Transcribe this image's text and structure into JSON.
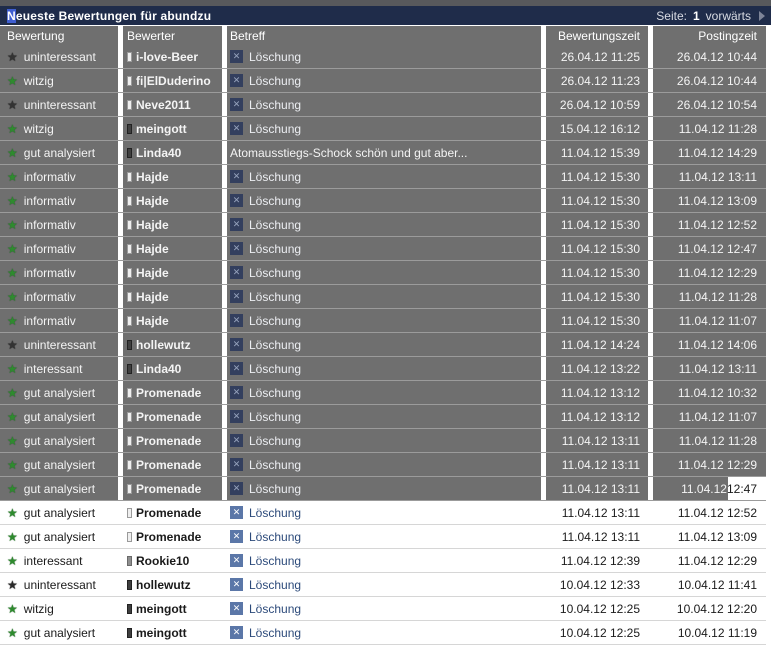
{
  "titlebar": {
    "title_anchor_char": "N",
    "title_rest": "euste",
    "title_full": "Neueste Bewertungen für abundzu",
    "title_selected_first": "N",
    "title_remainder": "eueste Bewertungen für abundzu",
    "page_label": "Seite:",
    "page_number": "1",
    "forward_label": "vorwärts"
  },
  "colors": {
    "titlebar_bg": "#1f2c4a",
    "top_strip": "#58595c",
    "header_bg": "#6f6f6f",
    "selection_bg": "#6f6f6f",
    "selection_anchor": "#3f5ed0",
    "link_blue": "#2c4a7a",
    "x_icon_bg": "#5b77a8",
    "x_icon_selected_bg": "#333f5e",
    "star_positive": "#2e8b2e",
    "star_negative": "#2b2b2b"
  },
  "columns": [
    {
      "label": "Bewertung",
      "align": "left"
    },
    {
      "label": "Bewerter",
      "align": "left"
    },
    {
      "label": "Betreff",
      "align": "left"
    },
    {
      "label": "Bewertungszeit",
      "align": "right"
    },
    {
      "label": "Postingzeit",
      "align": "right"
    }
  ],
  "subject_delete_label": "Löschung",
  "rows": [
    {
      "rating": "uninteressant",
      "rating_type": "neg",
      "user": "i-love-Beer",
      "user_icon": "light",
      "subject_kind": "delete_link",
      "subject": "Löschung",
      "btime": "26.04.12 11:25",
      "ptime": "26.04.12 10:44",
      "selected": true
    },
    {
      "rating": "witzig",
      "rating_type": "pos",
      "user": "fi|ElDuderino",
      "user_icon": "light",
      "subject_kind": "delete_link",
      "subject": "Löschung",
      "btime": "26.04.12 11:23",
      "ptime": "26.04.12 10:44",
      "selected": true
    },
    {
      "rating": "uninteressant",
      "rating_type": "neg",
      "user": "Neve2011",
      "user_icon": "light",
      "subject_kind": "delete_link",
      "subject": "Löschung",
      "btime": "26.04.12 10:59",
      "ptime": "26.04.12 10:54",
      "selected": true
    },
    {
      "rating": "witzig",
      "rating_type": "pos",
      "user": "meingott",
      "user_icon": "dark",
      "subject_kind": "delete_link",
      "subject": "Löschung",
      "btime": "15.04.12 16:12",
      "ptime": "11.04.12 11:28",
      "selected": true
    },
    {
      "rating": "gut analysiert",
      "rating_type": "pos",
      "user": "Linda40",
      "user_icon": "dark",
      "subject_kind": "text",
      "subject": "Atomausstiegs-Schock schön und gut aber...",
      "btime": "11.04.12 15:39",
      "ptime": "11.04.12 14:29",
      "selected": true
    },
    {
      "rating": "informativ",
      "rating_type": "pos",
      "user": "Hajde",
      "user_icon": "light",
      "subject_kind": "delete_link",
      "subject": "Löschung",
      "btime": "11.04.12 15:30",
      "ptime": "11.04.12 13:11",
      "selected": true
    },
    {
      "rating": "informativ",
      "rating_type": "pos",
      "user": "Hajde",
      "user_icon": "light",
      "subject_kind": "delete_link",
      "subject": "Löschung",
      "btime": "11.04.12 15:30",
      "ptime": "11.04.12 13:09",
      "selected": true
    },
    {
      "rating": "informativ",
      "rating_type": "pos",
      "user": "Hajde",
      "user_icon": "light",
      "subject_kind": "delete_link",
      "subject": "Löschung",
      "btime": "11.04.12 15:30",
      "ptime": "11.04.12 12:52",
      "selected": true
    },
    {
      "rating": "informativ",
      "rating_type": "pos",
      "user": "Hajde",
      "user_icon": "light",
      "subject_kind": "delete_link",
      "subject": "Löschung",
      "btime": "11.04.12 15:30",
      "ptime": "11.04.12 12:47",
      "selected": true
    },
    {
      "rating": "informativ",
      "rating_type": "pos",
      "user": "Hajde",
      "user_icon": "light",
      "subject_kind": "delete_link",
      "subject": "Löschung",
      "btime": "11.04.12 15:30",
      "ptime": "11.04.12 12:29",
      "selected": true
    },
    {
      "rating": "informativ",
      "rating_type": "pos",
      "user": "Hajde",
      "user_icon": "light",
      "subject_kind": "delete_link",
      "subject": "Löschung",
      "btime": "11.04.12 15:30",
      "ptime": "11.04.12 11:28",
      "selected": true
    },
    {
      "rating": "informativ",
      "rating_type": "pos",
      "user": "Hajde",
      "user_icon": "light",
      "subject_kind": "delete_link",
      "subject": "Löschung",
      "btime": "11.04.12 15:30",
      "ptime": "11.04.12 11:07",
      "selected": true
    },
    {
      "rating": "uninteressant",
      "rating_type": "neg",
      "user": "hollewutz",
      "user_icon": "dark",
      "subject_kind": "delete_link",
      "subject": "Löschung",
      "btime": "11.04.12 14:24",
      "ptime": "11.04.12 14:06",
      "selected": true
    },
    {
      "rating": "interessant",
      "rating_type": "pos",
      "user": "Linda40",
      "user_icon": "dark",
      "subject_kind": "delete_link",
      "subject": "Löschung",
      "btime": "11.04.12 13:22",
      "ptime": "11.04.12 13:11",
      "selected": true
    },
    {
      "rating": "gut analysiert",
      "rating_type": "pos",
      "user": "Promenade",
      "user_icon": "light",
      "subject_kind": "delete_link",
      "subject": "Löschung",
      "btime": "11.04.12 13:12",
      "ptime": "11.04.12 10:32",
      "selected": true
    },
    {
      "rating": "gut analysiert",
      "rating_type": "pos",
      "user": "Promenade",
      "user_icon": "light",
      "subject_kind": "delete_link",
      "subject": "Löschung",
      "btime": "11.04.12 13:12",
      "ptime": "11.04.12 11:07",
      "selected": true
    },
    {
      "rating": "gut analysiert",
      "rating_type": "pos",
      "user": "Promenade",
      "user_icon": "light",
      "subject_kind": "delete_link",
      "subject": "Löschung",
      "btime": "11.04.12 13:11",
      "ptime": "11.04.12 11:28",
      "selected": true
    },
    {
      "rating": "gut analysiert",
      "rating_type": "pos",
      "user": "Promenade",
      "user_icon": "light",
      "subject_kind": "delete_link",
      "subject": "Löschung",
      "btime": "11.04.12 13:11",
      "ptime": "11.04.12 12:29",
      "selected": true
    },
    {
      "rating": "gut analysiert",
      "rating_type": "pos",
      "user": "Promenade",
      "user_icon": "light",
      "subject_kind": "delete_link",
      "subject": "Löschung",
      "btime": "11.04.12 13:11",
      "ptime_selected_part": "11.04.12 ",
      "ptime_unselected_part": "12:47",
      "ptime": "11.04.12 12:47",
      "selected": true,
      "partial": true
    },
    {
      "rating": "gut analysiert",
      "rating_type": "pos",
      "user": "Promenade",
      "user_icon": "light",
      "subject_kind": "delete_link",
      "subject": "Löschung",
      "btime": "11.04.12 13:11",
      "ptime": "11.04.12 12:52",
      "selected": false
    },
    {
      "rating": "gut analysiert",
      "rating_type": "pos",
      "user": "Promenade",
      "user_icon": "light",
      "subject_kind": "delete_link",
      "subject": "Löschung",
      "btime": "11.04.12 13:11",
      "ptime": "11.04.12 13:09",
      "selected": false
    },
    {
      "rating": "interessant",
      "rating_type": "pos",
      "user": "Rookie10",
      "user_icon": "mid",
      "subject_kind": "delete_link",
      "subject": "Löschung",
      "btime": "11.04.12 12:39",
      "ptime": "11.04.12 12:29",
      "selected": false
    },
    {
      "rating": "uninteressant",
      "rating_type": "neg",
      "user": "hollewutz",
      "user_icon": "dark",
      "subject_kind": "delete_link",
      "subject": "Löschung",
      "btime": "10.04.12 12:33",
      "ptime": "10.04.12 11:41",
      "selected": false
    },
    {
      "rating": "witzig",
      "rating_type": "pos",
      "user": "meingott",
      "user_icon": "dark",
      "subject_kind": "delete_link",
      "subject": "Löschung",
      "btime": "10.04.12 12:25",
      "ptime": "10.04.12 12:20",
      "selected": false
    },
    {
      "rating": "gut analysiert",
      "rating_type": "pos",
      "user": "meingott",
      "user_icon": "dark",
      "subject_kind": "delete_link",
      "subject": "Löschung",
      "btime": "10.04.12 12:25",
      "ptime": "10.04.12 11:19",
      "selected": false
    }
  ],
  "icons": {
    "star": "★",
    "delete_x": "✕",
    "forward_arrow": "right-triangle"
  }
}
